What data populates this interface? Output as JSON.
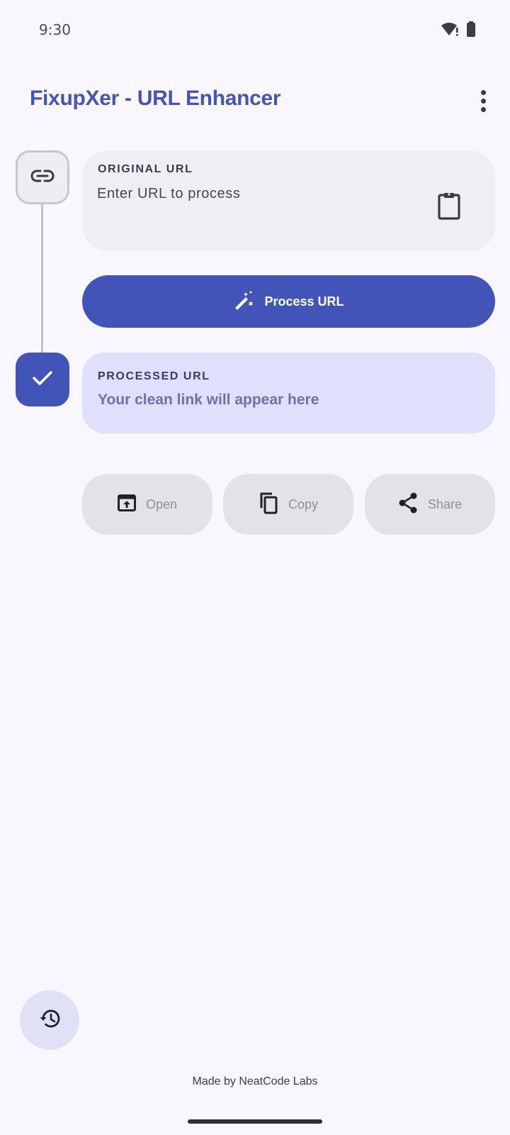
{
  "status_bar": {
    "time": "9:30",
    "icons": [
      "wifi-alert-icon",
      "battery-icon"
    ]
  },
  "app_bar": {
    "title": "FixupXer - URL Enhancer",
    "menu_icon": "more-vert-icon"
  },
  "original": {
    "label": "ORIGINAL URL",
    "placeholder": "Enter URL to process",
    "value": "",
    "paste_icon": "clipboard-icon"
  },
  "process_button": {
    "label": "Process URL",
    "icon": "magic-wand-icon"
  },
  "processed": {
    "label": "PROCESSED URL",
    "text": "Your clean link will appear here"
  },
  "actions": [
    {
      "label": "Open",
      "icon": "open-in-browser-icon"
    },
    {
      "label": "Copy",
      "icon": "copy-icon"
    },
    {
      "label": "Share",
      "icon": "share-icon"
    }
  ],
  "history_fab": {
    "icon": "history-icon"
  },
  "footer": {
    "text": "Made by NeatCode Labs"
  },
  "colors": {
    "primary": "#4354b8",
    "primary_container": "#dee0fc",
    "surface": "#f9f7fd",
    "surface_variant": "#efeef4",
    "disabled_button": "#e3e2e8"
  }
}
